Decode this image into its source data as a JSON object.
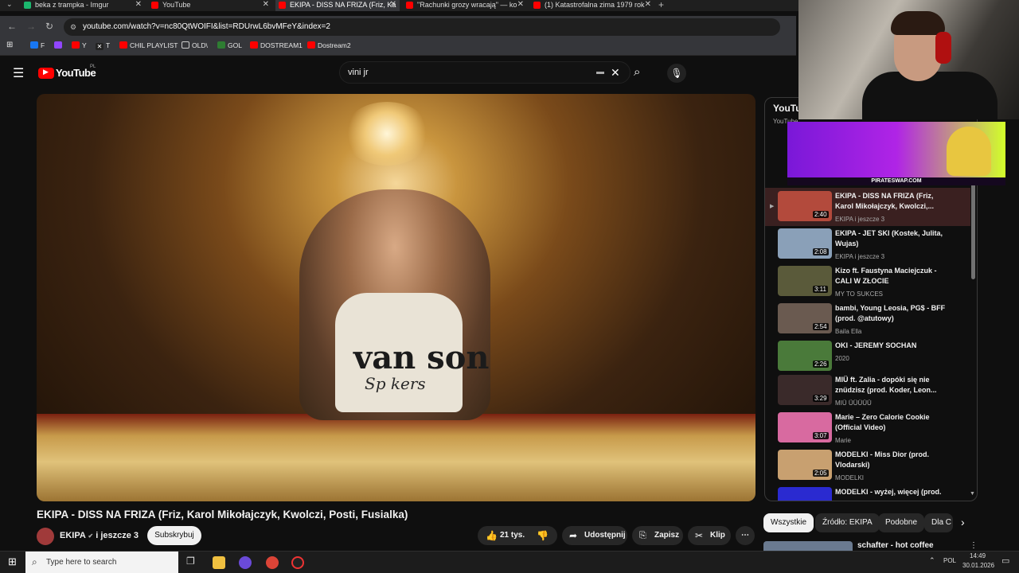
{
  "browser": {
    "tabs": [
      {
        "title": "beka z trampka - Imgur",
        "color": "#1bb76e"
      },
      {
        "title": "YouTube",
        "color": "#ff0000"
      },
      {
        "title": "EKIPA - DISS NA FRIZA (Friz, Ka",
        "color": "#ff0000",
        "active": true
      },
      {
        "title": "\"Rachunki grozy wracają\" — ko",
        "color": "#ff0000"
      },
      {
        "title": "(1) Katastrofalna zima 1979 rok",
        "color": "#ff0000"
      }
    ],
    "new_tab": "+",
    "url": "youtube.com/watch?v=nc80QtWOIFI&list=RDUrwL6bvMFeY&index=2",
    "bookmarks": [
      {
        "label": "F",
        "color": "#1877f2"
      },
      {
        "label": "",
        "color": "#9146ff"
      },
      {
        "label": "Y",
        "color": "#ff0000"
      },
      {
        "label": "T",
        "color": "#222222"
      },
      {
        "label": "CHIL PLAYLIST",
        "color": "#ff0000"
      },
      {
        "label": "OLD\\",
        "color": "#888888"
      },
      {
        "label": "GOL",
        "color": "#2e7d32"
      },
      {
        "label": "DOSTREAM1",
        "color": "#ff0000"
      },
      {
        "label": "Dostream2",
        "color": "#ff0000"
      }
    ]
  },
  "youtube": {
    "logo": "YouTube",
    "logo_region": "PL",
    "search_value": "vini jr",
    "video_title": "EKIPA - DISS NA FRIZA (Friz, Karol Mikołajczyk, Kwolczi, Posti, Fusialka)",
    "channel": "EKIPA",
    "channel_extra": "i jeszcze 3",
    "subscribe": "Subskrybuj",
    "likes": "21 tys.",
    "share": "Udostępnij",
    "save": "Zapisz",
    "clip": "Klip",
    "video_art": {
      "shirt_text": "van son",
      "sub_text": "Sp  kers"
    }
  },
  "playlist": {
    "header": "YouTu",
    "header_sub": "YouTube",
    "items": [
      {
        "title": "EKIPA - DISS NA FRIZA (Friz, Karol Mikołajczyk, Kwolczi,...",
        "channel": "EKIPA i jeszcze 3",
        "duration": "2:40",
        "thumb": "#b34a3c",
        "now_playing": "▶"
      },
      {
        "title": "EKIPA - JET SKI (Kostek, Julita, Wujas)",
        "channel": "EKIPA i jeszcze 3",
        "duration": "2:08",
        "thumb": "#8aa0b8"
      },
      {
        "title": "Kizo ft. Faustyna Maciejczuk - CALI W ZŁOCIE",
        "channel": "MY TO SUKCES",
        "duration": "3:11",
        "thumb": "#5a5a3a"
      },
      {
        "title": "bambi, Young Leosia, PG$ - BFF (prod. @atutowy)",
        "channel": "Baila Ella",
        "duration": "2:54",
        "thumb": "#6a5a50"
      },
      {
        "title": "OKI - JEREMY SOCHAN",
        "channel": "2020",
        "duration": "2:26",
        "thumb": "#4a7a3a"
      },
      {
        "title": "MIÜ ft. Zalia - dopóki się nie znüdzisz (prod. Koder, Leon...",
        "channel": "MIÜ ÜÜÜÜÜ",
        "duration": "3:29",
        "thumb": "#3a2a2a"
      },
      {
        "title": "Marie – Zero Calorie Cookie (Official Video)",
        "channel": "Marie",
        "duration": "3:07",
        "thumb": "#d86aa0"
      },
      {
        "title": "MODELKI - Miss Dior (prod. Vlodarski)",
        "channel": "MODELKI",
        "duration": "2:05",
        "thumb": "#c8a070"
      },
      {
        "title": "MODELKI - wyżej, więcej (prod.",
        "channel": "",
        "duration": "",
        "thumb": "#2a2ad0"
      }
    ]
  },
  "chips": [
    "Wszystkie",
    "Źródło: EKIPA",
    "Podobne",
    "Dla C"
  ],
  "next_video": {
    "title": "schafter - hot coffee"
  },
  "overlay": {
    "banner_caption": "PIRATESWAP.COM"
  },
  "taskbar": {
    "search_placeholder": "Type here to search",
    "language": "POL",
    "time": "14:49",
    "date": "30.01.2026"
  }
}
